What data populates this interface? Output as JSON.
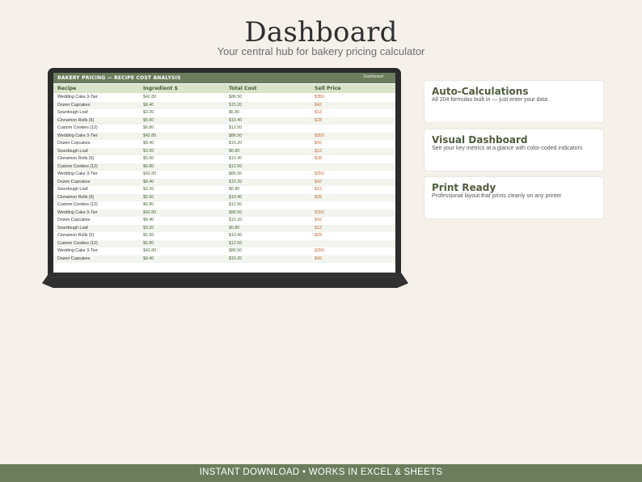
{
  "header": {
    "title": "Dashboard",
    "subtitle": "Your central hub for bakery pricing calculator"
  },
  "sheet": {
    "title": "BAKERY PRICING — RECIPE COST ANALYSIS",
    "tab": "Dashboard",
    "columns": [
      "Recipe",
      "Ingredient $",
      "Total Cost",
      "Sell Price"
    ],
    "rows": [
      [
        "Wedding Cake 3-Tier",
        "$42.80",
        "$86.50",
        "$350"
      ],
      [
        "Dozen Cupcakes",
        "$8.40",
        "$15.20",
        "$42"
      ],
      [
        "Sourdough Loaf",
        "$3.20",
        "$6.80",
        "$12"
      ],
      [
        "Cinnamon Rolls (6)",
        "$5.60",
        "$10.40",
        "$28"
      ],
      [
        "Custom Cookies (12)",
        "$6.80",
        "$12.50",
        ""
      ],
      [
        "Wedding Cake 3-Tier",
        "$42.80",
        "$86.50",
        "$350"
      ],
      [
        "Dozen Cupcakes",
        "$8.40",
        "$15.20",
        "$42"
      ],
      [
        "Sourdough Loaf",
        "$3.20",
        "$6.80",
        "$12"
      ],
      [
        "Cinnamon Rolls (6)",
        "$5.60",
        "$10.40",
        "$28"
      ],
      [
        "Custom Cookies (12)",
        "$6.80",
        "$12.50",
        ""
      ],
      [
        "Wedding Cake 3-Tier",
        "$42.80",
        "$86.50",
        "$350"
      ],
      [
        "Dozen Cupcakes",
        "$8.40",
        "$15.20",
        "$42"
      ],
      [
        "Sourdough Loaf",
        "$3.20",
        "$6.80",
        "$12"
      ],
      [
        "Cinnamon Rolls (6)",
        "$5.60",
        "$10.40",
        "$28"
      ],
      [
        "Custom Cookies (12)",
        "$6.80",
        "$12.50",
        ""
      ],
      [
        "Wedding Cake 3-Tier",
        "$42.80",
        "$86.50",
        "$350"
      ],
      [
        "Dozen Cupcakes",
        "$8.40",
        "$15.20",
        "$42"
      ],
      [
        "Sourdough Loaf",
        "$3.20",
        "$6.80",
        "$12"
      ],
      [
        "Cinnamon Rolls (6)",
        "$5.60",
        "$10.40",
        "$28"
      ],
      [
        "Custom Cookies (12)",
        "$6.80",
        "$12.50",
        ""
      ],
      [
        "Wedding Cake 3-Tier",
        "$42.80",
        "$86.50",
        "$350"
      ],
      [
        "Dozen Cupcakes",
        "$8.40",
        "$15.20",
        "$42"
      ]
    ]
  },
  "features": [
    {
      "title": "Auto-Calculations",
      "desc": "All 204 formulas built in — just enter your data"
    },
    {
      "title": "Visual Dashboard",
      "desc": "See your key metrics at a glance with color-coded indicators"
    },
    {
      "title": "Print Ready",
      "desc": "Professional layout that prints cleanly on any printer"
    }
  ],
  "footer": {
    "text": "INSTANT DOWNLOAD  •  WORKS IN EXCEL & SHEETS"
  },
  "colors": {
    "background": "#f5f0ea",
    "accent_green": "#6b7d5c",
    "header_light_green": "#d8e3ca",
    "price_orange": "#c06a3a",
    "laptop": "#2b2b2b"
  }
}
